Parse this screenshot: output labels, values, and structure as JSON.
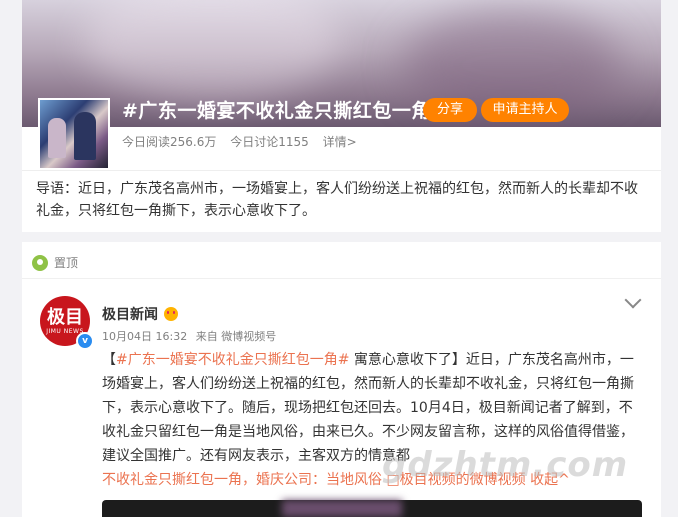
{
  "topic": {
    "title": "#广东一婚宴不收礼金只撕红包一角#",
    "share_label": "分享",
    "host_label": "申请主持人",
    "reads": "今日阅读256.6万",
    "discussions": "今日讨论1155",
    "details": "详情>",
    "lead": "导语：近日，广东茂名高州市，一场婚宴上，客人们纷纷送上祝福的红包，然而新人的长辈却不收礼金，只将红包一角撕下，表示心意收下了。"
  },
  "post": {
    "pinned_label": "置顶",
    "avatar_text": "极目",
    "avatar_subtext": "JIMU NEWS",
    "verified_mark": "v",
    "author": "极目新闻",
    "date": "10月04日 16:32",
    "source": "来自 微博视频号",
    "bracket_open": "【",
    "hashtag": "#广东一婚宴不收礼金只撕红包一角#",
    "summary_head": " 寓意心意收下了】",
    "body": "近日，广东茂名高州市，一场婚宴上，客人们纷纷送上祝福的红包，然而新人的长辈却不收礼金，只将红包一角撕下，表示心意收下了。随后，现场把红包还回去。10月4日，极目新闻记者了解到，不收礼金只留红包一角是当地风俗，由来已久。不少网友留言称，这样的风俗值得借鉴，建议全国推广。还有网友表示，主客双方的情意都",
    "link_text": "不收礼金只撕红包一角，婚庆公司：当地风俗",
    "video_link": "□极目视频的微博视频",
    "collapse": "收起^"
  },
  "watermark": "gdzhtm.com",
  "colors": {
    "accent": "#ff8200",
    "link": "#eb7350",
    "brand_red": "#c8161d"
  }
}
